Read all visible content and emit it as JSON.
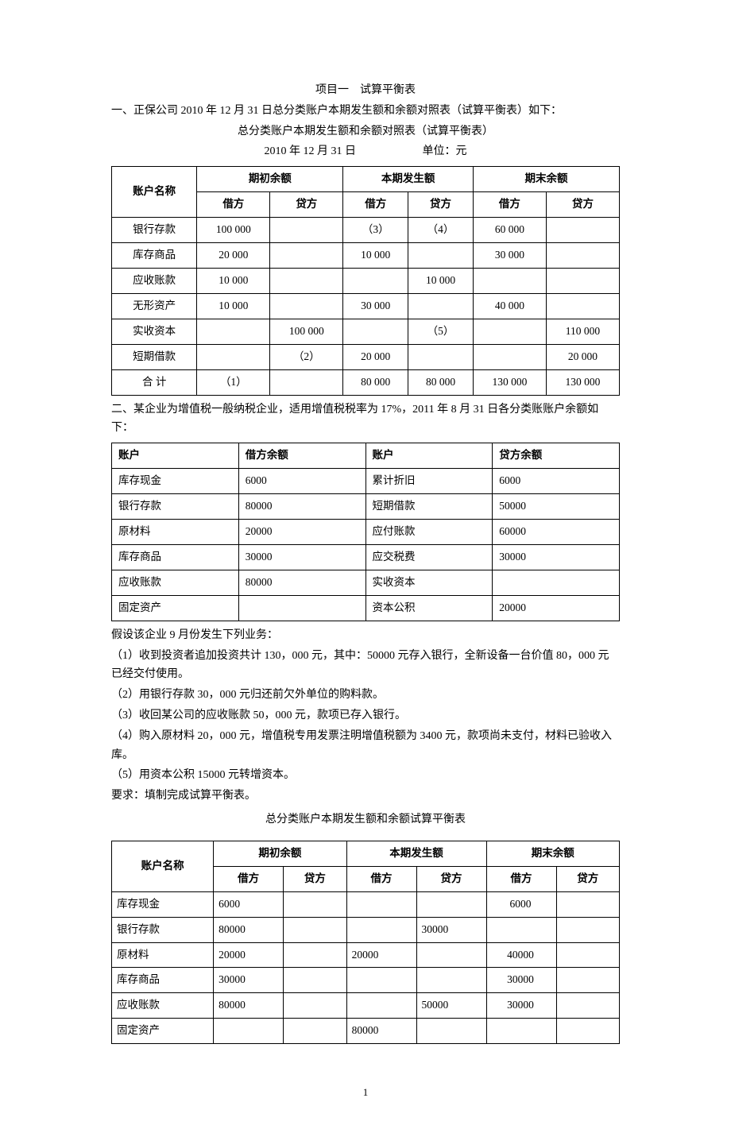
{
  "project_title": "项目一　试算平衡表",
  "sec1_heading": "一、正保公司 2010 年 12 月 31 日总分类账户本期发生额和余额对照表（试算平衡表）如下：",
  "table1_caption": "总分类账户本期发生额和余额对照表（试算平衡表）",
  "table1_date": "2010 年 12 月 31 日",
  "table1_unit": "单位：元",
  "table1": {
    "head": {
      "acct": "账户名称",
      "open": "期初余额",
      "period": "本期发生额",
      "close": "期末余额",
      "dr": "借方",
      "cr": "贷方"
    },
    "rows": [
      {
        "name": "银行存款",
        "od": "100 000",
        "oc": "",
        "pd": "（3）",
        "pc": "（4）",
        "cd": "60 000",
        "cc": ""
      },
      {
        "name": "库存商品",
        "od": "20 000",
        "oc": "",
        "pd": "10 000",
        "pc": "",
        "cd": "30 000",
        "cc": ""
      },
      {
        "name": "应收账款",
        "od": "10 000",
        "oc": "",
        "pd": "",
        "pc": "10 000",
        "cd": "",
        "cc": ""
      },
      {
        "name": "无形资产",
        "od": "10 000",
        "oc": "",
        "pd": "30 000",
        "pc": "",
        "cd": "40 000",
        "cc": ""
      },
      {
        "name": "实收资本",
        "od": "",
        "oc": "100 000",
        "pd": "",
        "pc": "（5）",
        "cd": "",
        "cc": "110 000"
      },
      {
        "name": "短期借款",
        "od": "",
        "oc": "（2）",
        "pd": "20 000",
        "pc": "",
        "cd": "",
        "cc": "20 000"
      },
      {
        "name": "合 计",
        "od": "（1）",
        "oc": "",
        "pd": "80 000",
        "pc": "80 000",
        "cd": "130 000",
        "cc": "130 000"
      }
    ]
  },
  "sec2_heading": "二、某企业为增值税一般纳税企业，适用增值税税率为 17%，2011 年 8 月 31 日各分类账账户余额如下：",
  "table2": {
    "head": {
      "c1": "账户",
      "c2": "借方余额",
      "c3": "账户",
      "c4": "贷方余额"
    },
    "rows": [
      {
        "c1": "库存现金",
        "c2": "6000",
        "c3": "累计折旧",
        "c4": "6000"
      },
      {
        "c1": "银行存款",
        "c2": "80000",
        "c3": "短期借款",
        "c4": "50000"
      },
      {
        "c1": "原材料",
        "c2": "20000",
        "c3": "应付账款",
        "c4": "60000"
      },
      {
        "c1": "库存商品",
        "c2": "30000",
        "c3": "应交税费",
        "c4": "30000"
      },
      {
        "c1": "应收账款",
        "c2": "80000",
        "c3": "实收资本",
        "c4": ""
      },
      {
        "c1": "固定资产",
        "c2": "",
        "c3": "资本公积",
        "c4": "20000"
      }
    ]
  },
  "assume_line": "假设该企业 9 月份发生下列业务：",
  "items": [
    "（1）收到投资者追加投资共计 130，000 元，其中：50000 元存入银行，全新设备一台价值 80，000 元已经交付使用。",
    "（2）用银行存款 30，000 元归还前欠外单位的购料款。",
    "（3）收回某公司的应收账款 50，000 元，款项已存入银行。",
    "（4）购入原材料 20，000 元，增值税专用发票注明增值税额为 3400 元，款项尚未支付，材料已验收入库。",
    "（5）用资本公积 15000 元转增资本。"
  ],
  "require_line": "要求：填制完成试算平衡表。",
  "table3_caption": "总分类账户本期发生额和余额试算平衡表",
  "table3": {
    "head": {
      "acct": "账户名称",
      "open": "期初余额",
      "period": "本期发生额",
      "close": "期末余额",
      "dr": "借方",
      "cr": "贷方"
    },
    "rows": [
      {
        "name": "库存现金",
        "od": "6000",
        "oc": "",
        "pd": "",
        "pc": "",
        "cd": "6000",
        "cc": ""
      },
      {
        "name": "银行存款",
        "od": "80000",
        "oc": "",
        "pd": "",
        "pc": "30000",
        "cd": "",
        "cc": ""
      },
      {
        "name": "原材料",
        "od": "20000",
        "oc": "",
        "pd": "20000",
        "pc": "",
        "cd": "40000",
        "cc": ""
      },
      {
        "name": "库存商品",
        "od": "30000",
        "oc": "",
        "pd": "",
        "pc": "",
        "cd": "30000",
        "cc": ""
      },
      {
        "name": "应收账款",
        "od": "80000",
        "oc": "",
        "pd": "",
        "pc": "50000",
        "cd": "30000",
        "cc": ""
      },
      {
        "name": "固定资产",
        "od": "",
        "oc": "",
        "pd": "80000",
        "pc": "",
        "cd": "",
        "cc": ""
      }
    ]
  },
  "page_number": "1"
}
